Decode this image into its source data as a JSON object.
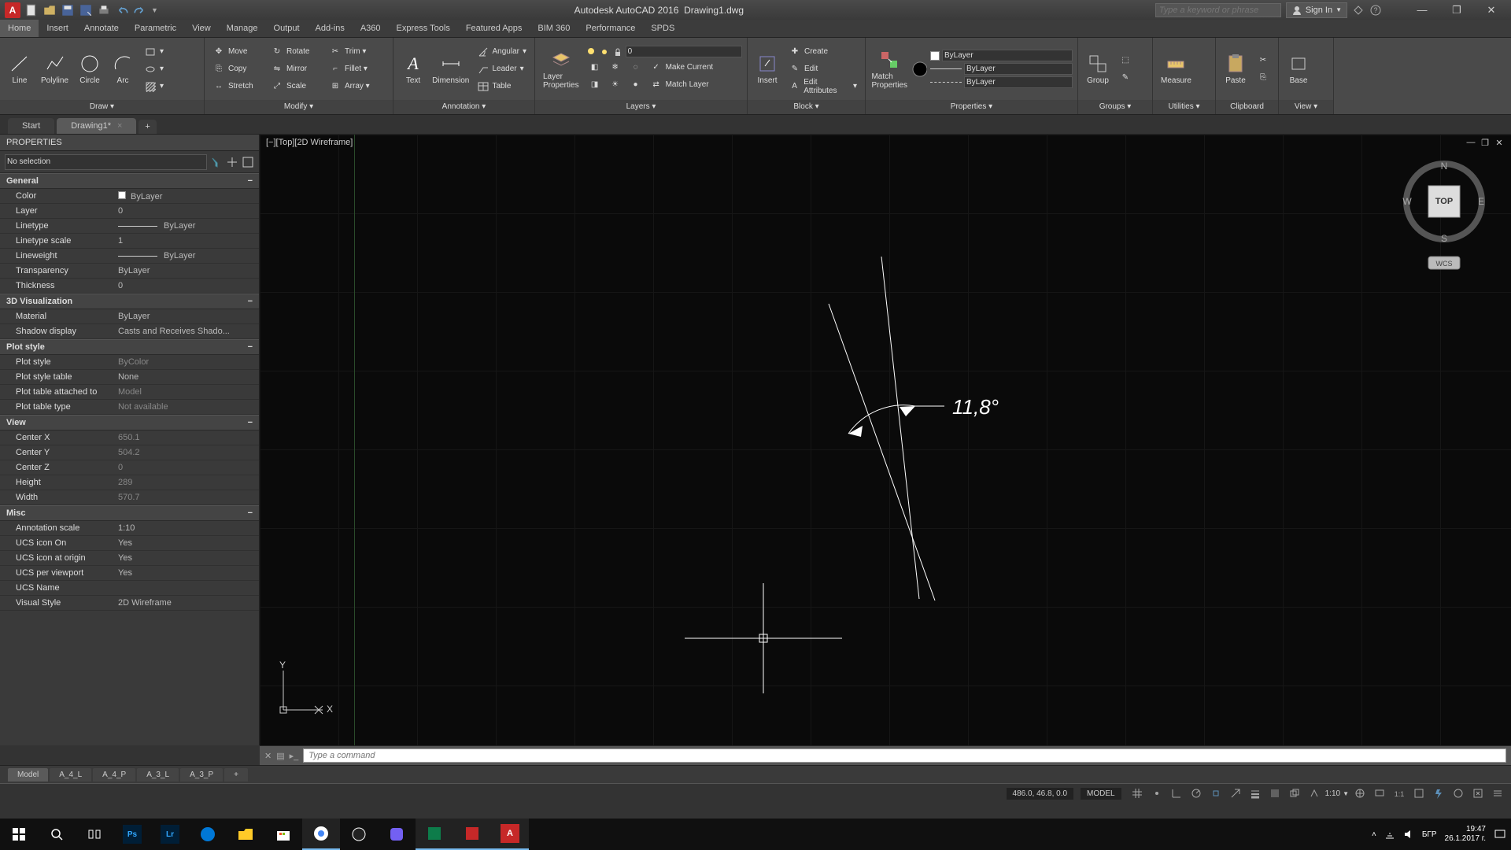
{
  "title": {
    "app": "Autodesk AutoCAD 2016",
    "file": "Drawing1.dwg"
  },
  "qat_icons": [
    "new-icon",
    "open-icon",
    "save-icon",
    "saveas-icon",
    "print-icon",
    "undo-icon",
    "redo-icon"
  ],
  "search_placeholder": "Type a keyword or phrase",
  "signin": "Sign In",
  "menubar": [
    "Home",
    "Insert",
    "Annotate",
    "Parametric",
    "View",
    "Manage",
    "Output",
    "Add-ins",
    "A360",
    "Express Tools",
    "Featured Apps",
    "BIM 360",
    "Performance",
    "SPDS"
  ],
  "active_menu": 0,
  "ribbon": {
    "draw": {
      "title": "Draw",
      "items": [
        "Line",
        "Polyline",
        "Circle",
        "Arc"
      ]
    },
    "modify": {
      "title": "Modify",
      "rows": [
        [
          "Move",
          "Rotate",
          "Trim"
        ],
        [
          "Copy",
          "Mirror",
          "Fillet"
        ],
        [
          "Stretch",
          "Scale",
          "Array"
        ]
      ]
    },
    "annotation": {
      "title": "Annotation",
      "big": [
        "Text",
        "Dimension"
      ],
      "rows": [
        "Angular",
        "Leader",
        "Table"
      ]
    },
    "layers": {
      "title": "Layers",
      "big": "Layer\nProperties",
      "sel": "0",
      "rows": [
        "Make Current",
        "Match Layer"
      ]
    },
    "block": {
      "title": "Block",
      "big": "Insert",
      "rows": [
        "Create",
        "Edit",
        "Edit Attributes"
      ]
    },
    "props": {
      "title": "Properties",
      "big": "Match\nProperties",
      "sels": [
        "ByLayer",
        "ByLayer",
        "ByLayer"
      ]
    },
    "groups": {
      "title": "Groups",
      "big": "Group"
    },
    "utilities": {
      "title": "Utilities",
      "big": "Measure"
    },
    "clipboard": {
      "title": "Clipboard",
      "big": "Paste"
    },
    "view": {
      "title": "View",
      "big": "Base"
    }
  },
  "doctabs": {
    "start": "Start",
    "active": "Drawing1*"
  },
  "props_panel": {
    "title": "PROPERTIES",
    "selector": "No selection",
    "cats": [
      {
        "name": "General",
        "rows": [
          [
            "Color",
            "ByLayer",
            false,
            true
          ],
          [
            "Layer",
            "0",
            false,
            false
          ],
          [
            "Linetype",
            "ByLayer",
            false,
            true
          ],
          [
            "Linetype scale",
            "1",
            false,
            false
          ],
          [
            "Lineweight",
            "ByLayer",
            false,
            true
          ],
          [
            "Transparency",
            "ByLayer",
            false,
            false
          ],
          [
            "Thickness",
            "0",
            false,
            false
          ]
        ]
      },
      {
        "name": "3D Visualization",
        "rows": [
          [
            "Material",
            "ByLayer",
            false,
            false
          ],
          [
            "Shadow display",
            "Casts and Receives Shado...",
            false,
            false
          ]
        ]
      },
      {
        "name": "Plot style",
        "rows": [
          [
            "Plot style",
            "ByColor",
            true,
            false
          ],
          [
            "Plot style table",
            "None",
            false,
            false
          ],
          [
            "Plot table attached to",
            "Model",
            true,
            false
          ],
          [
            "Plot table type",
            "Not available",
            true,
            false
          ]
        ]
      },
      {
        "name": "View",
        "rows": [
          [
            "Center X",
            "650.1",
            true,
            false
          ],
          [
            "Center Y",
            "504.2",
            true,
            false
          ],
          [
            "Center Z",
            "0",
            true,
            false
          ],
          [
            "Height",
            "289",
            true,
            false
          ],
          [
            "Width",
            "570.7",
            true,
            false
          ]
        ]
      },
      {
        "name": "Misc",
        "rows": [
          [
            "Annotation scale",
            "1:10",
            false,
            false
          ],
          [
            "UCS icon On",
            "Yes",
            false,
            false
          ],
          [
            "UCS icon at origin",
            "Yes",
            false,
            false
          ],
          [
            "UCS per viewport",
            "Yes",
            false,
            false
          ],
          [
            "UCS Name",
            "",
            false,
            false
          ],
          [
            "Visual Style",
            "2D Wireframe",
            false,
            false
          ]
        ]
      }
    ]
  },
  "viewport_label": "[−][Top][2D Wireframe]",
  "angle_dim": "11,8°",
  "viewcube": {
    "top": "TOP",
    "n": "N",
    "e": "E",
    "s": "S",
    "w": "W",
    "wcs": "WCS"
  },
  "ucs": {
    "x": "X",
    "y": "Y"
  },
  "cmd_placeholder": "Type a command",
  "layout_tabs": [
    "Model",
    "A_4_L",
    "A_4_P",
    "A_3_L",
    "A_3_P"
  ],
  "status": {
    "coords": "486.0, 46.8, 0.0",
    "model": "MODEL",
    "scale": "1:10"
  },
  "tray": {
    "lang": "БГР",
    "time": "19:47",
    "date": "26.1.2017 г."
  }
}
